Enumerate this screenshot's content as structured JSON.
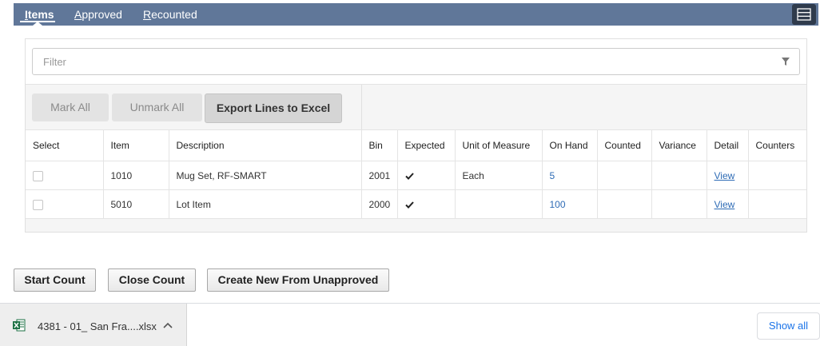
{
  "tabs": [
    {
      "label": "Items",
      "mnemonic": "I",
      "rest": "tems",
      "active": true
    },
    {
      "label": "Approved",
      "mnemonic": "A",
      "rest": "pproved",
      "active": false
    },
    {
      "label": "Recounted",
      "mnemonic": "R",
      "rest": "ecounted",
      "active": false
    }
  ],
  "menu_icon": "hamburger-menu-icon",
  "filter": {
    "placeholder": "Filter",
    "value": "",
    "icon": "filter-funnel-icon"
  },
  "toolbar": {
    "mark_all": "Mark All",
    "unmark_all": "Unmark All",
    "export": "Export Lines to Excel"
  },
  "table": {
    "columns": [
      "Select",
      "Item",
      "Description",
      "Bin",
      "Expected",
      "Unit of Measure",
      "On Hand",
      "Counted",
      "Variance",
      "Detail",
      "Counters"
    ],
    "rows": [
      {
        "selected": false,
        "item": "1010",
        "description": "Mug Set, RF-SMART",
        "bin": "2001",
        "expected": true,
        "uom": "Each",
        "on_hand": "5",
        "counted": "",
        "variance": "",
        "detail": "View",
        "counters": ""
      },
      {
        "selected": false,
        "item": "5010",
        "description": "Lot Item",
        "bin": "2000",
        "expected": true,
        "uom": "",
        "on_hand": "100",
        "counted": "",
        "variance": "",
        "detail": "View",
        "counters": ""
      }
    ]
  },
  "actions": {
    "start_count": "Start Count",
    "close_count": "Close Count",
    "create_new": "Create New From Unapproved"
  },
  "downloads": {
    "file_name": "4381 - 01_ San Fra....xlsx",
    "file_icon": "excel-file-icon",
    "show_all": "Show all"
  },
  "colors": {
    "tab_bar": "#607799",
    "menu_button": "#2f3b4c",
    "link": "#2e6bb5",
    "show_all": "#1a73e8"
  }
}
